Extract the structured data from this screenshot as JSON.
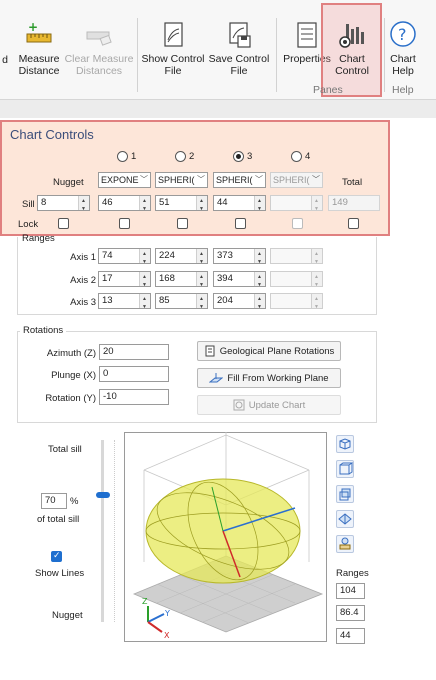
{
  "ribbon": {
    "partial_label": "d",
    "measure_distance": "Measure\nDistance",
    "clear_measure": "Clear Measure\nDistances",
    "show_control_file": "Show Control\nFile",
    "save_control_file": "Save Control\nFile",
    "properties": "Properties",
    "chart_control": "Chart\nControl",
    "chart_help": "Chart\nHelp",
    "group_panes": "Panes",
    "group_help": "Help"
  },
  "chart_controls": {
    "title": "Chart Controls",
    "radios": [
      "1",
      "2",
      "3",
      "4"
    ],
    "selected_radio": "3",
    "nugget_label": "Nugget",
    "total_label": "Total",
    "structures": [
      "EXPONE",
      "SPHERI(",
      "SPHERI(",
      "SPHERI("
    ],
    "sill_label": "Sill",
    "sill_values": [
      "8",
      "46",
      "51",
      "44",
      ""
    ],
    "total_sill": "149",
    "lock_label": "Lock"
  },
  "ranges": {
    "title": "Ranges",
    "axis1_label": "Axis 1",
    "axis2_label": "Axis 2",
    "axis3_label": "Axis 3",
    "axis1": [
      "74",
      "224",
      "373"
    ],
    "axis2": [
      "17",
      "168",
      "394"
    ],
    "axis3": [
      "13",
      "85",
      "204"
    ]
  },
  "rotations": {
    "title": "Rotations",
    "azimuth_label": "Azimuth (Z)",
    "azimuth": "20",
    "plunge_label": "Plunge (X)",
    "plunge": "0",
    "rotation_label": "Rotation (Y)",
    "rotation": "-10",
    "geo_plane_btn": "Geological Plane Rotations",
    "fill_btn": "Fill From Working Plane",
    "update_btn": "Update Chart"
  },
  "view": {
    "total_sill_label": "Total sill",
    "percent_value": "70",
    "percent_sign": "%",
    "of_total_sill": "of total sill",
    "show_lines_label": "Show Lines",
    "nugget_label": "Nugget",
    "ranges_label": "Ranges",
    "range_values": [
      "104",
      "86.4",
      "44"
    ],
    "slider_fraction": 0.7,
    "axis_labels": {
      "z": "Z",
      "y": "Y",
      "x": "X"
    }
  },
  "colors": {
    "highlight_border": "#e08080",
    "accent_blue": "#1f6fcf",
    "ellipsoid": "#e6e85a",
    "title_blue": "#3a4d7a"
  }
}
